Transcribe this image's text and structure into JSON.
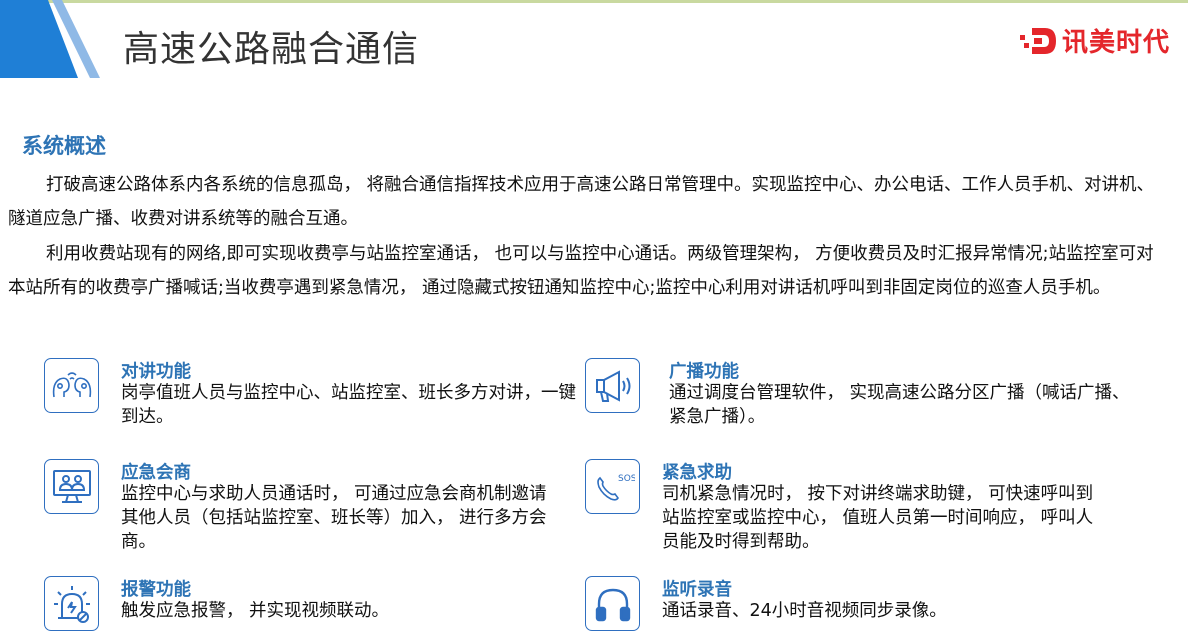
{
  "header": {
    "title": "高速公路融合通信",
    "logo_text": "讯美时代",
    "accent_color": "#1f7fd6",
    "logo_color": "#e4262b"
  },
  "overview": {
    "title": "系统概述",
    "paragraph1": "打破高速公路体系内各系统的信息孤岛， 将融合通信指挥技术应用于高速公路日常管理中。实现监控中心、办公电话、工作人员手机、对讲机、隧道应急广播、收费对讲系统等的融合互通。",
    "paragraph2": "利用收费站现有的网络,即可实现收费亭与站监控室通话， 也可以与监控中心通话。两级管理架构， 方便收费员及时汇报异常情况;站监控室可对本站所有的收费亭广播喊话;当收费亭遇到紧急情况， 通过隐藏式按钮通知监控中心;监控中心利用对讲话机呼叫到非固定岗位的巡查人员手机。"
  },
  "features": [
    {
      "title": "对讲功能",
      "desc": "岗亭值班人员与监控中心、站监控室、班长多方对讲，一键到达。",
      "icon": "intercom-icon"
    },
    {
      "title": "广播功能",
      "desc": "通过调度台管理软件， 实现高速公路分区广播（喊话广播、紧急广播）。",
      "icon": "megaphone-icon"
    },
    {
      "title": "应急会商",
      "desc": "监控中心与求助人员通话时， 可通过应急会商机制邀请其他人员（包括站监控室、班长等）加入， 进行多方会商。",
      "icon": "conference-icon"
    },
    {
      "title": "紧急求助",
      "desc": "司机紧急情况时， 按下对讲终端求助键， 可快速呼叫到站监控室或监控中心， 值班人员第一时间响应， 呼叫人员能及时得到帮助。",
      "icon": "sos-phone-icon"
    },
    {
      "title": "报警功能",
      "desc": "触发应急报警， 并实现视频联动。",
      "icon": "alarm-icon"
    },
    {
      "title": "监听录音",
      "desc": "通话录音、24小时音视频同步录像。",
      "icon": "headphones-icon"
    }
  ],
  "icon_color": "#2f6fc0",
  "title_color": "#2e74b5"
}
